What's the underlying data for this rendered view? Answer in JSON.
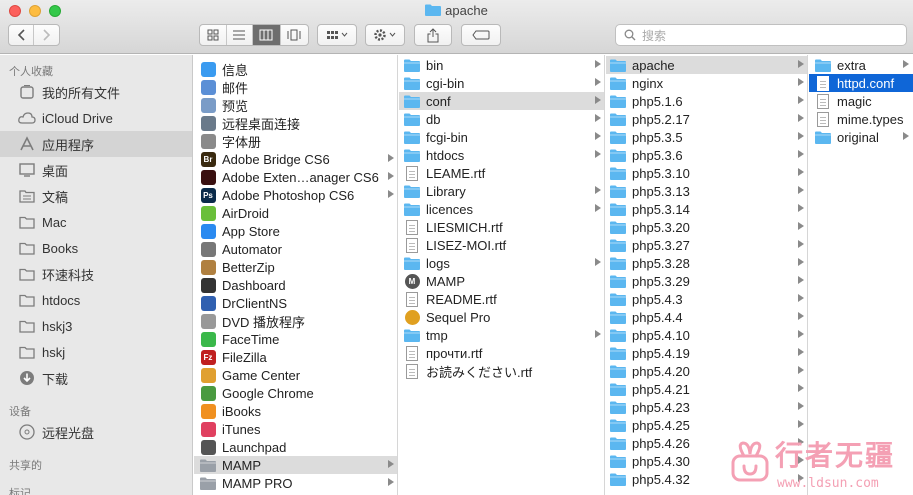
{
  "window": {
    "title": "apache"
  },
  "toolbar": {
    "search_placeholder": "搜索",
    "icons": [
      "back-icon",
      "forward-icon",
      "icon-view-icon",
      "list-view-icon",
      "column-view-icon",
      "coverflow-view-icon",
      "arrange-icon",
      "gear-icon",
      "share-icon",
      "tag-icon",
      "search-icon"
    ]
  },
  "sidebar": {
    "favorites_header": "个人收藏",
    "favorites": [
      {
        "label": "我的所有文件",
        "icon": "all-files-icon"
      },
      {
        "label": "iCloud Drive",
        "icon": "cloud-icon"
      },
      {
        "label": "应用程序",
        "icon": "applications-icon",
        "selected": true
      },
      {
        "label": "桌面",
        "icon": "desktop-icon"
      },
      {
        "label": "文稿",
        "icon": "documents-icon"
      },
      {
        "label": "Mac",
        "icon": "folder-icon"
      },
      {
        "label": "Books",
        "icon": "folder-icon"
      },
      {
        "label": "环速科技",
        "icon": "folder-icon"
      },
      {
        "label": "htdocs",
        "icon": "folder-icon"
      },
      {
        "label": "hskj3",
        "icon": "folder-icon"
      },
      {
        "label": "hskj",
        "icon": "folder-icon"
      },
      {
        "label": "下载",
        "icon": "downloads-icon"
      }
    ],
    "devices_header": "设备",
    "devices": [
      {
        "label": "远程光盘",
        "icon": "disc-icon"
      }
    ],
    "shared_header": "共享的",
    "tags_header": "标记"
  },
  "columns": {
    "applications": [
      {
        "label": "信息",
        "icon": "messages-icon",
        "color": "#3a9bf0"
      },
      {
        "label": "邮件",
        "icon": "mail-icon",
        "color": "#5b8fd6"
      },
      {
        "label": "预览",
        "icon": "preview-icon",
        "color": "#7a9cc7"
      },
      {
        "label": "远程桌面连接",
        "icon": "remote-desktop-icon",
        "color": "#6a7a8a"
      },
      {
        "label": "字体册",
        "icon": "font-book-icon",
        "color": "#8a8a8a"
      },
      {
        "label": "Adobe Bridge CS6",
        "icon": "bridge-icon",
        "color": "#3a2a10",
        "text": "Br",
        "arrow": true
      },
      {
        "label": "Adobe Exten…anager CS6",
        "icon": "extension-manager-icon",
        "color": "#3a1010",
        "arrow": true
      },
      {
        "label": "Adobe Photoshop CS6",
        "icon": "photoshop-icon",
        "color": "#0a2a4a",
        "text": "Ps",
        "arrow": true
      },
      {
        "label": "AirDroid",
        "icon": "airdroid-icon",
        "color": "#6abf3a"
      },
      {
        "label": "App Store",
        "icon": "app-store-icon",
        "color": "#2a8af0"
      },
      {
        "label": "Automator",
        "icon": "automator-icon",
        "color": "#777"
      },
      {
        "label": "BetterZip",
        "icon": "betterzip-icon",
        "color": "#b08040"
      },
      {
        "label": "Dashboard",
        "icon": "dashboard-icon",
        "color": "#333"
      },
      {
        "label": "DrClientNS",
        "icon": "drclient-icon",
        "color": "#3060b0"
      },
      {
        "label": "DVD 播放程序",
        "icon": "dvd-player-icon",
        "color": "#999"
      },
      {
        "label": "FaceTime",
        "icon": "facetime-icon",
        "color": "#3ab84a"
      },
      {
        "label": "FileZilla",
        "icon": "filezilla-icon",
        "color": "#c02020",
        "text": "Fz"
      },
      {
        "label": "Game Center",
        "icon": "game-center-icon",
        "color": "#e0a030"
      },
      {
        "label": "Google Chrome",
        "icon": "chrome-icon",
        "color": "#4a9a40"
      },
      {
        "label": "iBooks",
        "icon": "ibooks-icon",
        "color": "#f09020"
      },
      {
        "label": "iTunes",
        "icon": "itunes-icon",
        "color": "#e04060"
      },
      {
        "label": "Launchpad",
        "icon": "launchpad-icon",
        "color": "#555"
      },
      {
        "label": "MAMP",
        "icon": "folder-icon",
        "color": "#9aa0a8",
        "arrow": true,
        "selected": true
      },
      {
        "label": "MAMP PRO",
        "icon": "folder-icon",
        "color": "#9aa0a8",
        "arrow": true
      }
    ],
    "mamp": [
      {
        "label": "bin",
        "type": "folder",
        "arrow": true
      },
      {
        "label": "cgi-bin",
        "type": "folder",
        "arrow": true
      },
      {
        "label": "conf",
        "type": "folder",
        "arrow": true,
        "selected": true
      },
      {
        "label": "db",
        "type": "folder",
        "arrow": true
      },
      {
        "label": "fcgi-bin",
        "type": "folder",
        "arrow": true
      },
      {
        "label": "htdocs",
        "type": "folder",
        "arrow": true
      },
      {
        "label": "LEAME.rtf",
        "type": "doc"
      },
      {
        "label": "Library",
        "type": "folder",
        "arrow": true
      },
      {
        "label": "licences",
        "type": "folder",
        "arrow": true
      },
      {
        "label": "LIESMICH.rtf",
        "type": "doc"
      },
      {
        "label": "LISEZ-MOI.rtf",
        "type": "doc"
      },
      {
        "label": "logs",
        "type": "folder",
        "arrow": true
      },
      {
        "label": "MAMP",
        "type": "app-mamp"
      },
      {
        "label": "README.rtf",
        "type": "doc"
      },
      {
        "label": "Sequel Pro",
        "type": "app-sequel"
      },
      {
        "label": "tmp",
        "type": "folder",
        "arrow": true
      },
      {
        "label": "прочти.rtf",
        "type": "doc"
      },
      {
        "label": "お読みください.rtf",
        "type": "doc"
      }
    ],
    "conf": [
      {
        "label": "apache",
        "selected": true
      },
      {
        "label": "nginx"
      },
      {
        "label": "php5.1.6"
      },
      {
        "label": "php5.2.17"
      },
      {
        "label": "php5.3.5"
      },
      {
        "label": "php5.3.6"
      },
      {
        "label": "php5.3.10"
      },
      {
        "label": "php5.3.13"
      },
      {
        "label": "php5.3.14"
      },
      {
        "label": "php5.3.20"
      },
      {
        "label": "php5.3.27"
      },
      {
        "label": "php5.3.28"
      },
      {
        "label": "php5.3.29"
      },
      {
        "label": "php5.4.3"
      },
      {
        "label": "php5.4.4"
      },
      {
        "label": "php5.4.10"
      },
      {
        "label": "php5.4.19"
      },
      {
        "label": "php5.4.20"
      },
      {
        "label": "php5.4.21"
      },
      {
        "label": "php5.4.23"
      },
      {
        "label": "php5.4.25"
      },
      {
        "label": "php5.4.26"
      },
      {
        "label": "php5.4.30"
      },
      {
        "label": "php5.4.32"
      }
    ],
    "apache": [
      {
        "label": "extra",
        "type": "folder",
        "arrow": true
      },
      {
        "label": "httpd.conf",
        "type": "doc",
        "selected": true
      },
      {
        "label": "magic",
        "type": "doc"
      },
      {
        "label": "mime.types",
        "type": "doc"
      },
      {
        "label": "original",
        "type": "folder",
        "arrow": true
      }
    ]
  },
  "watermark": {
    "text": "行者无疆",
    "url": "www.ldsun.com"
  },
  "colors": {
    "folder": "#5bb7f0",
    "selection_blue": "#0f66d7",
    "selection_grey": "#dcdcdc"
  }
}
